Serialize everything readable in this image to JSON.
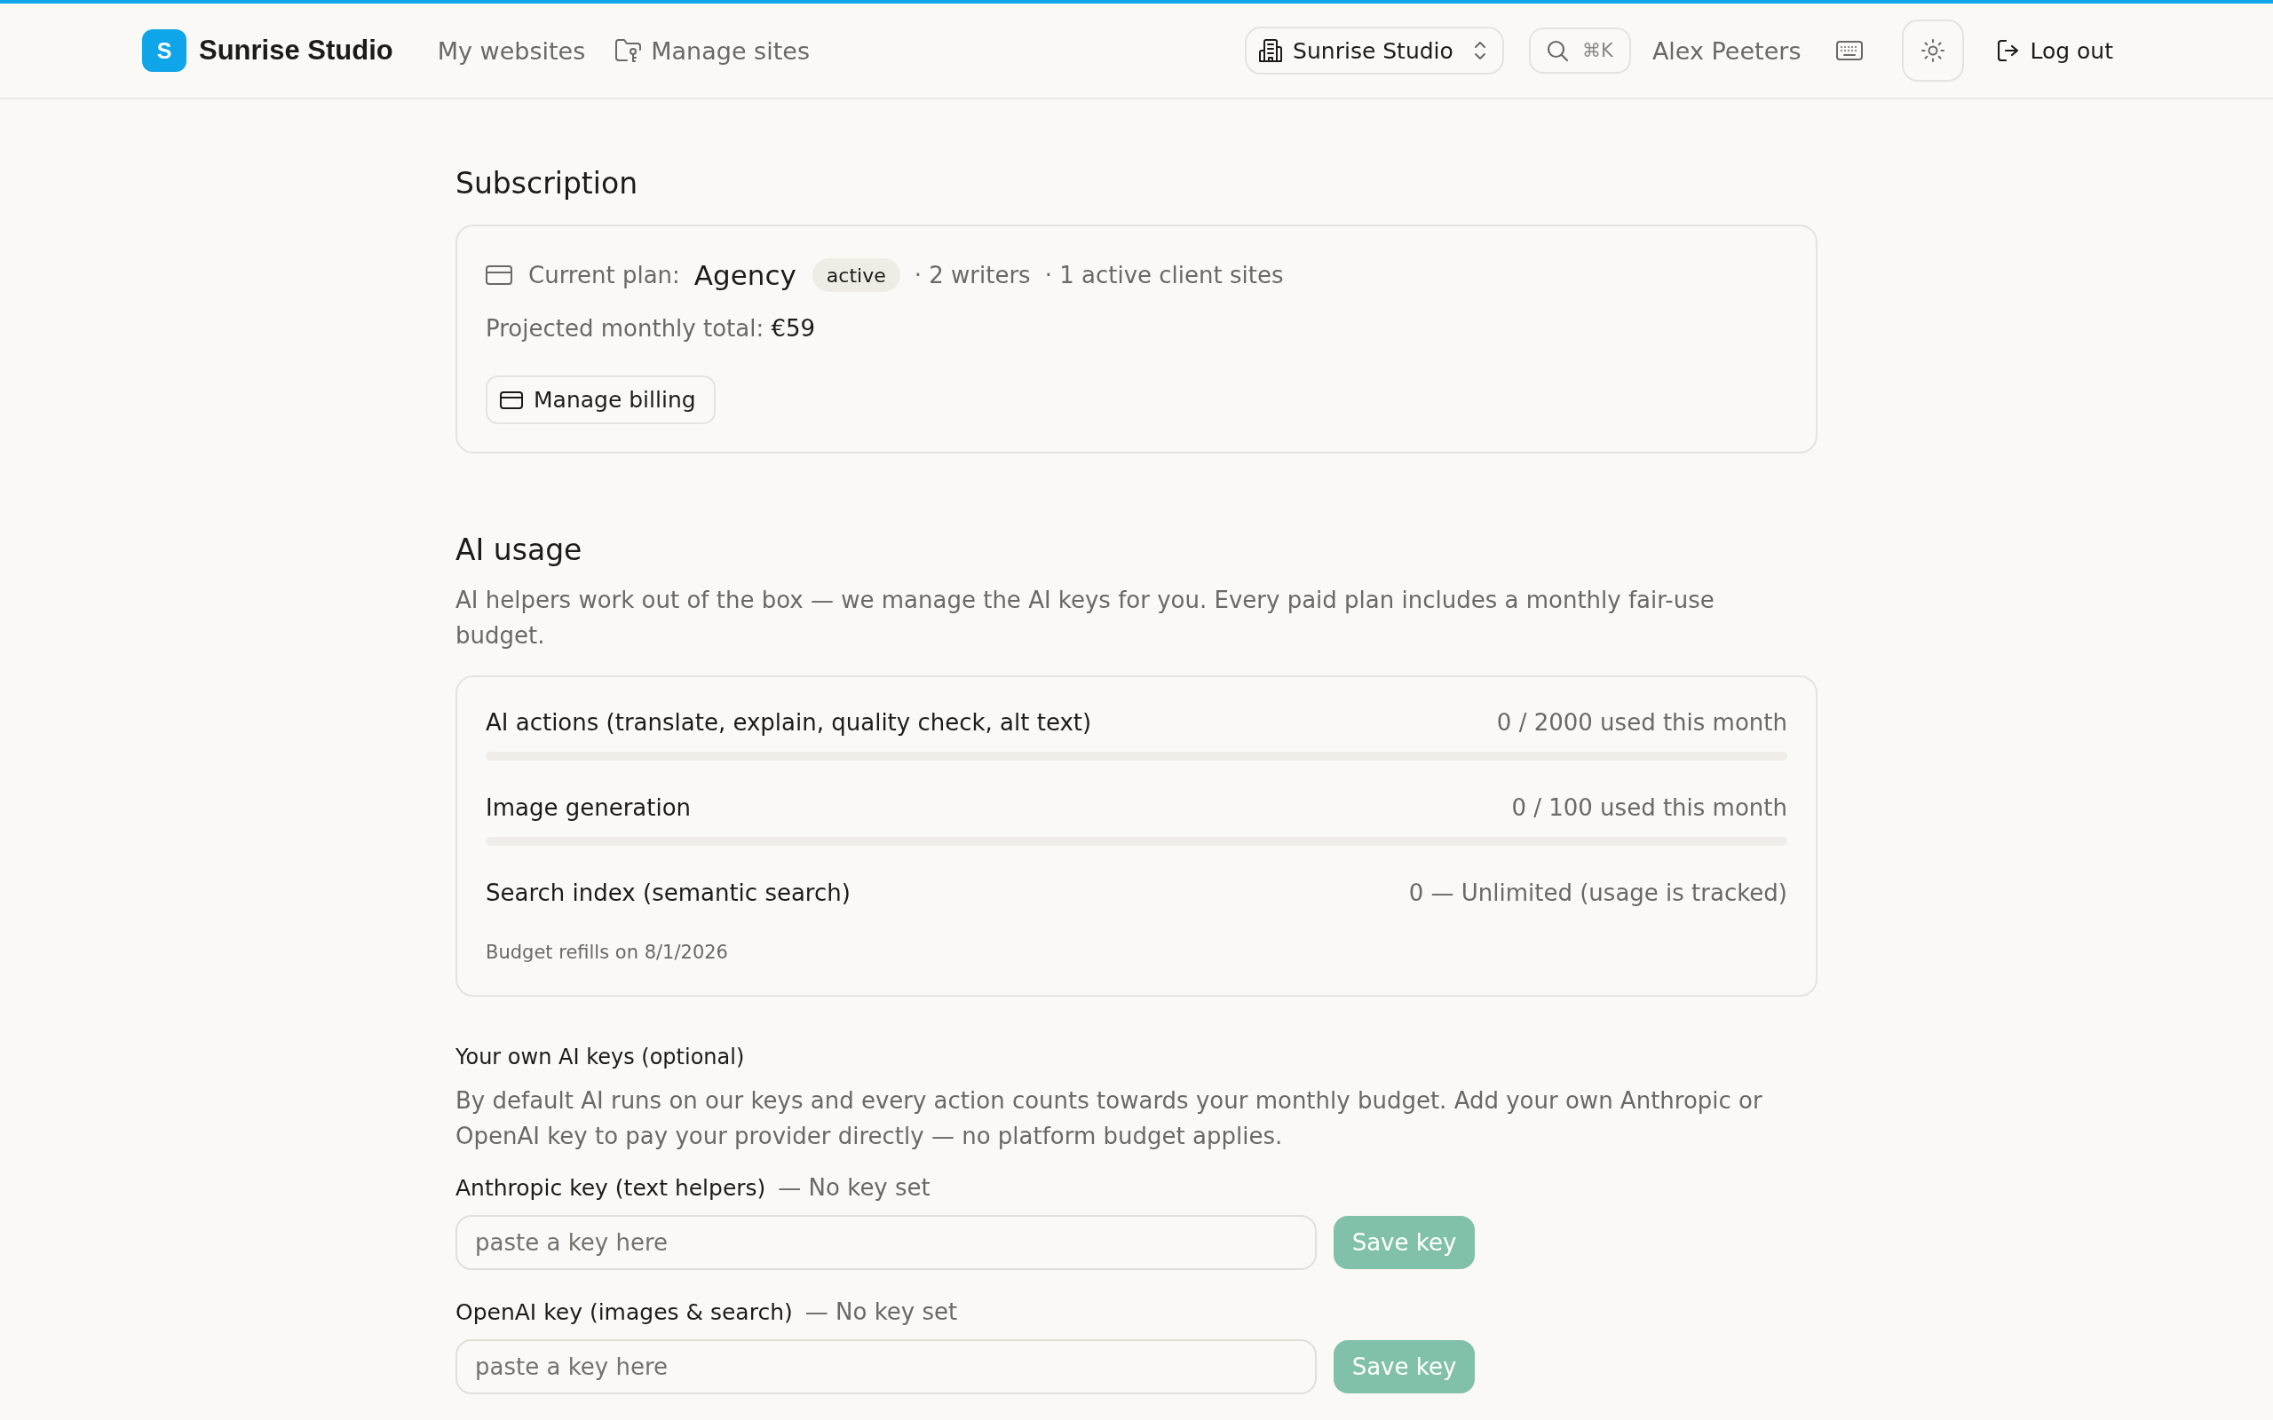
{
  "header": {
    "brand": {
      "initial": "S",
      "name": "Sunrise Studio"
    },
    "nav": [
      {
        "label": "My websites",
        "kind": "plain"
      },
      {
        "label": "Manage sites",
        "kind": "folder"
      }
    ],
    "workspace": "Sunrise Studio",
    "search_shortcut": "⌘K",
    "user": "Alex Peeters",
    "logout": "Log out"
  },
  "subscription": {
    "title": "Subscription",
    "plan_label": "Current plan:",
    "plan_name": "Agency",
    "status": "active",
    "details": [
      "· 2 writers",
      "· 1 active client sites"
    ],
    "total": "Projected monthly total: **€59**",
    "button": "Manage billing"
  },
  "ai_usage": {
    "title": "AI usage",
    "description": "AI helpers work out of the box — we manage the AI keys for you. Every paid plan includes a monthly fair-use budget.",
    "meters": [
      {
        "label": "AI actions (translate, explain, quality check, alt text)",
        "reading": "0 / 2000 used this month",
        "kind": "bar",
        "level": 0
      },
      {
        "label": "Image generation",
        "reading": "0 / 100 used this month",
        "kind": "bar",
        "level": 0
      },
      {
        "label": "Search index (semantic search)",
        "reading": "0 — Unlimited (usage is tracked)",
        "kind": "plain"
      }
    ],
    "refill_note": "Budget refills on 8/1/2026"
  },
  "own_keys": {
    "title": "Your own AI keys (optional)",
    "description": "By default AI runs on our keys and every action counts towards your monthly budget. Add your own Anthropic or OpenAI key to pay your provider directly — no platform budget applies.",
    "keys": [
      {
        "label": "Anthropic key (text helpers)",
        "status": "— No key set",
        "placeholder": "paste a key here",
        "button": "Save key",
        "disabled": true
      },
      {
        "label": "OpenAI key (images & search)",
        "status": "— No key set",
        "placeholder": "paste a key here",
        "button": "Save key",
        "disabled": true
      }
    ]
  }
}
